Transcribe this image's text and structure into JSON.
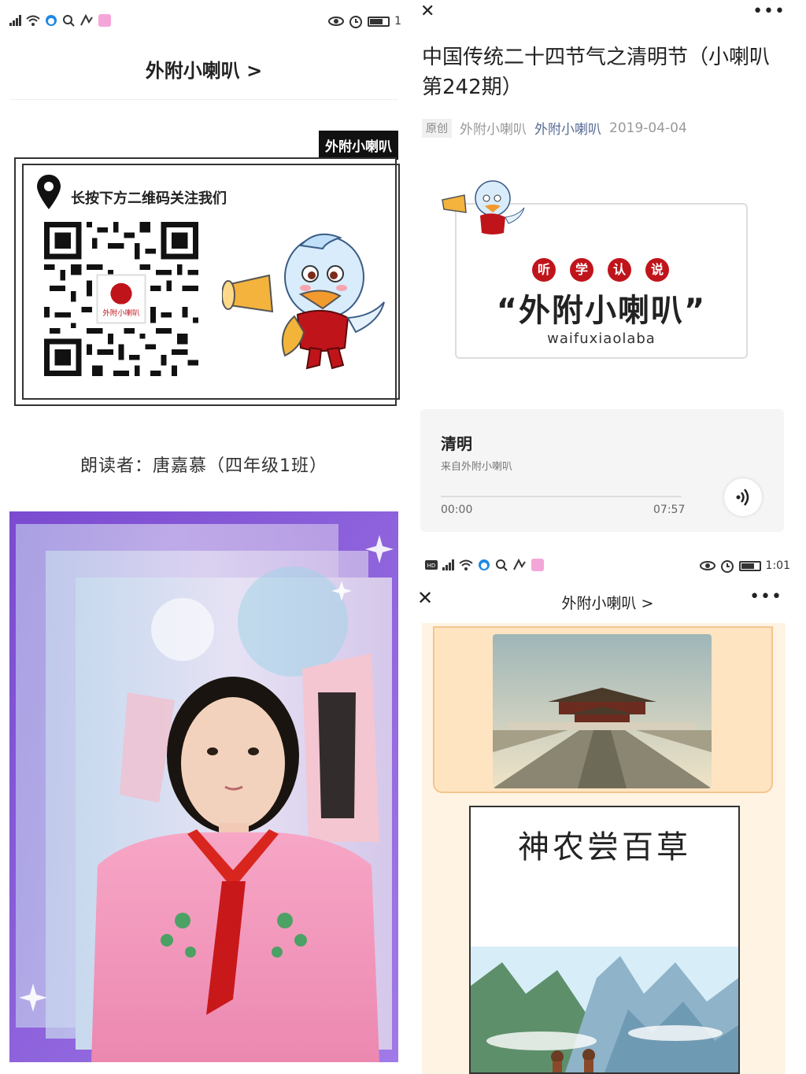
{
  "left_panel": {
    "status_bar": {
      "clock_partial": "1"
    },
    "nav_title": "外附小喇叭 >",
    "tag": "外附小喇叭",
    "qr_hint": "长按下方二维码关注我们",
    "qr_center_label": "外附小喇叭",
    "reader": "朗读者：唐嘉慕（四年级1班）"
  },
  "article": {
    "title": "中国传统二十四节气之清明节（小喇叭第242期）",
    "badge_original": "原创",
    "author": "外附小喇叭",
    "account": "外附小喇叭",
    "date": "2019-04-04",
    "banner": {
      "badges": [
        "听",
        "学",
        "认",
        "说"
      ],
      "brand": "“外附小喇叭”",
      "pinyin": "waifuxiaolaba"
    },
    "audio": {
      "title": "清明",
      "source": "来自外附小喇叭",
      "time_current": "00:00",
      "time_total": "07:57",
      "progress": 0
    }
  },
  "second_screen": {
    "status_bar": {
      "clock": "1:01"
    },
    "nav_title": "外附小喇叭 >",
    "card_title": "神农尝百草"
  },
  "colors": {
    "accent_red": "#c0141b",
    "link_blue": "#576b95",
    "audio_bg": "#f5f5f5",
    "content_bg": "#fff3e3"
  }
}
